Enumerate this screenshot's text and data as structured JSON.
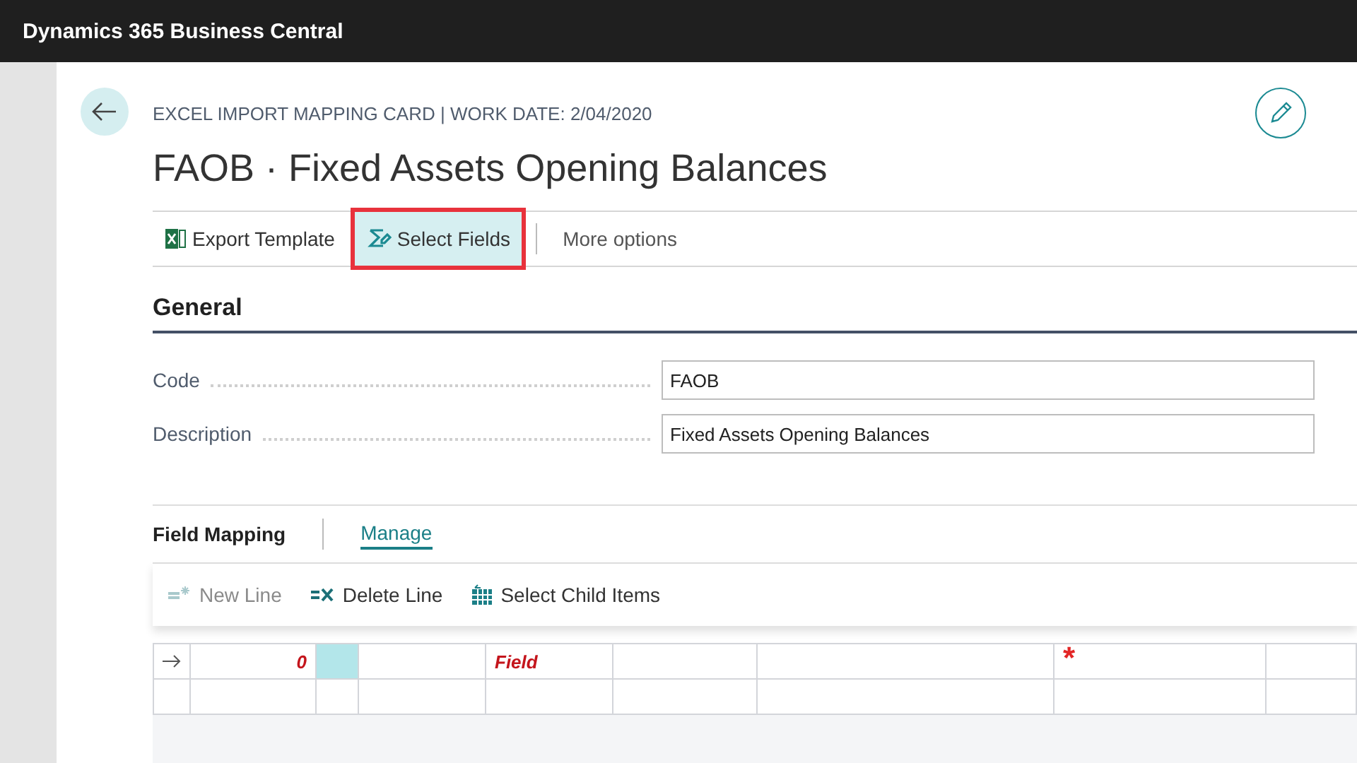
{
  "app_bar": {
    "title": "Dynamics 365 Business Central"
  },
  "caption": "EXCEL IMPORT MAPPING CARD | WORK DATE: 2/04/2020",
  "title": "FAOB · Fixed Assets Opening Balances",
  "actions": [
    {
      "kind": "excel",
      "label": "Export Template",
      "highlighted": false
    },
    {
      "kind": "select",
      "label": "Select Fields",
      "highlighted": true
    },
    {
      "kind": "more",
      "label": "More options",
      "highlighted": false
    }
  ],
  "section": "General",
  "fields": [
    {
      "label": "Code",
      "value": "FAOB"
    },
    {
      "label": "Description",
      "value": "Fixed Assets Opening Balances"
    }
  ],
  "part": {
    "title": "Field Mapping",
    "tabs": [
      {
        "label": "Manage",
        "selected": true
      }
    ],
    "actions": [
      {
        "kind": "new",
        "label": "New Line",
        "disabled": true
      },
      {
        "kind": "delete",
        "label": "Delete Line",
        "disabled": false
      },
      {
        "kind": "child",
        "label": "Select Child Items",
        "disabled": false
      }
    ],
    "rows": [
      {
        "current": true,
        "order": "0",
        "type": "Field",
        "constant_value": "*"
      },
      {
        "current": false,
        "order": "",
        "type": "",
        "constant_value": ""
      }
    ]
  }
}
